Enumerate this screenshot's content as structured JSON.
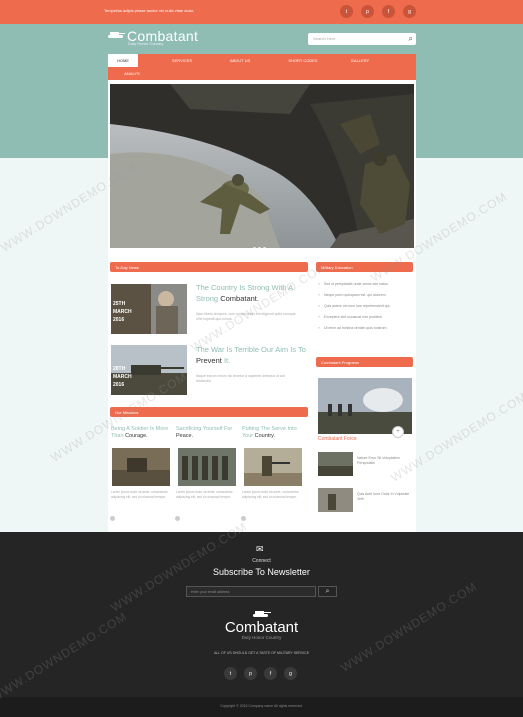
{
  "topbar": {
    "tagline": "Tempellus adipis phase auctor vel nulla vitae dolor.",
    "social": [
      "t",
      "p",
      "f",
      "g"
    ]
  },
  "brand": {
    "name": "Combatant",
    "tagline": "Duty Honor Country"
  },
  "search": {
    "placeholder": "Search Here",
    "icon": "search-icon"
  },
  "nav": {
    "items": [
      "HOME",
      "SERVICES",
      "ABOUT US",
      "SHORT CODES",
      "GALLERY",
      "ANALYS"
    ],
    "active": "HOME"
  },
  "sections": {
    "today_news": "To-Day News",
    "military_education": "Military Education",
    "missions": "Our Missions",
    "programs": "Combatant Programs"
  },
  "news": [
    {
      "title_pre": "The Country Is Strong With A Strong ",
      "title_strong": "Combatant.",
      "text": "Nam libero tempore, cum soluta nobis est eligendi optio cumque nihil impedit quo minus.",
      "day": "25TH",
      "month": "MARCH",
      "year": "2016"
    },
    {
      "title_pre": "The War Is Terrible Our Aim Is To ",
      "title_strong": "Prevent",
      "title_post": " It.",
      "text": "Itaque earum rerum hic tenetur a sapiente delectus ut aut reiciendis.",
      "day": "28TH",
      "month": "MARCH",
      "year": "2016"
    }
  ],
  "education": [
    "Sed ut perspiciatis unde omnis iste natus.",
    "Neque porro quisquam est, qui dolorem.",
    "Quis autem vel eum iure reprehenderit qui.",
    "Excepteur sint occaecat non proident.",
    "Ut enim ad minima veniam quis nostrum."
  ],
  "missions": [
    {
      "title_pre": "Being A Soldier Is More Than ",
      "title_strong": "Courage.",
      "text": "Lorem ipsum dolor sit amet, consectetur adipiscing elit, sed do eiusmod tempor."
    },
    {
      "title_pre": "Sacrificing Yourself For ",
      "title_strong": "Peace.",
      "text": "Lorem ipsum dolor sit amet, consectetur adipiscing elit, sed do eiusmod tempor."
    },
    {
      "title_pre": "Putting The Serve Into Your ",
      "title_strong": "Country.",
      "text": "Lorem ipsum dolor sit amet, consectetur adipiscing elit, sed do eiusmod tempor."
    }
  ],
  "programs": {
    "featured_caption": "Combatant Force",
    "items": [
      {
        "text": "Nature Error Sit Voluptatem Perspiciatis"
      },
      {
        "text": "Quis Aute Irure Dolor In Vulputate Velit"
      }
    ]
  },
  "newsletter": {
    "connect": "Connect",
    "title": "Subscribe To Newsletter",
    "placeholder": "enter your email address"
  },
  "footer": {
    "brand": "Combatant",
    "tagline": "Duty Honor Country",
    "motto": "ALL OF US SHOULD GET A TASTE OF MILITARY SERVICE",
    "copyright": "Copyright © 2016 Company name All rights reserved."
  },
  "watermark": "WWW.DOWNDEMO.COM",
  "colors": {
    "accent": "#ee6b4d",
    "teal": "#8fbdb4",
    "dark": "#252525"
  }
}
